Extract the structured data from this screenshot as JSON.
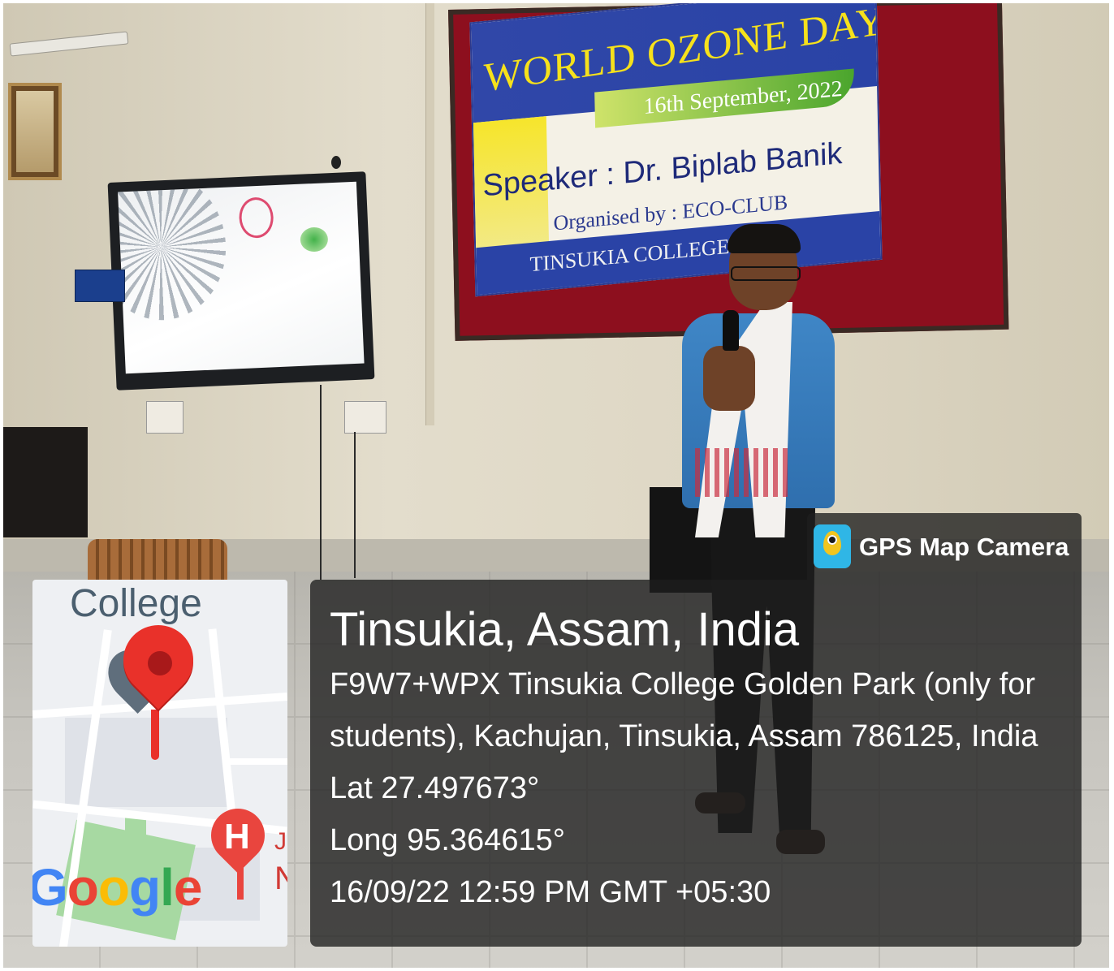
{
  "banner": {
    "title": "WORLD OZONE DAY",
    "date": "16th September, 2022",
    "speaker": "Speaker : Dr. Biplab Banik",
    "organised_by": "Organised by : ECO-CLUB",
    "college": "TINSUKIA COLLEGE, T"
  },
  "gps_badge": {
    "label": "GPS Map Camera",
    "icon": "gps-map-camera-icon"
  },
  "location": {
    "title": "Tinsukia, Assam, India",
    "address_line_1": "F9W7+WPX Tinsukia College Golden Park (only for",
    "address_line_2": "students), Kachujan, Tinsukia, Assam 786125, India",
    "lat": "Lat 27.497673°",
    "long": "Long 95.364615°",
    "timestamp": "16/09/22 12:59 PM GMT +05:30"
  },
  "map": {
    "place_label": "College",
    "poi_letter": "H",
    "edge_label_1": "J",
    "edge_label_2": "N",
    "brand": [
      "G",
      "o",
      "o",
      "g",
      "l",
      "e"
    ]
  },
  "colors": {
    "overlay": "#1e1e1e",
    "pin_red": "#e9312a",
    "banner_blue": "#2a43a6",
    "banner_yellow": "#f6e11b",
    "board_red": "#8d0f1e"
  }
}
